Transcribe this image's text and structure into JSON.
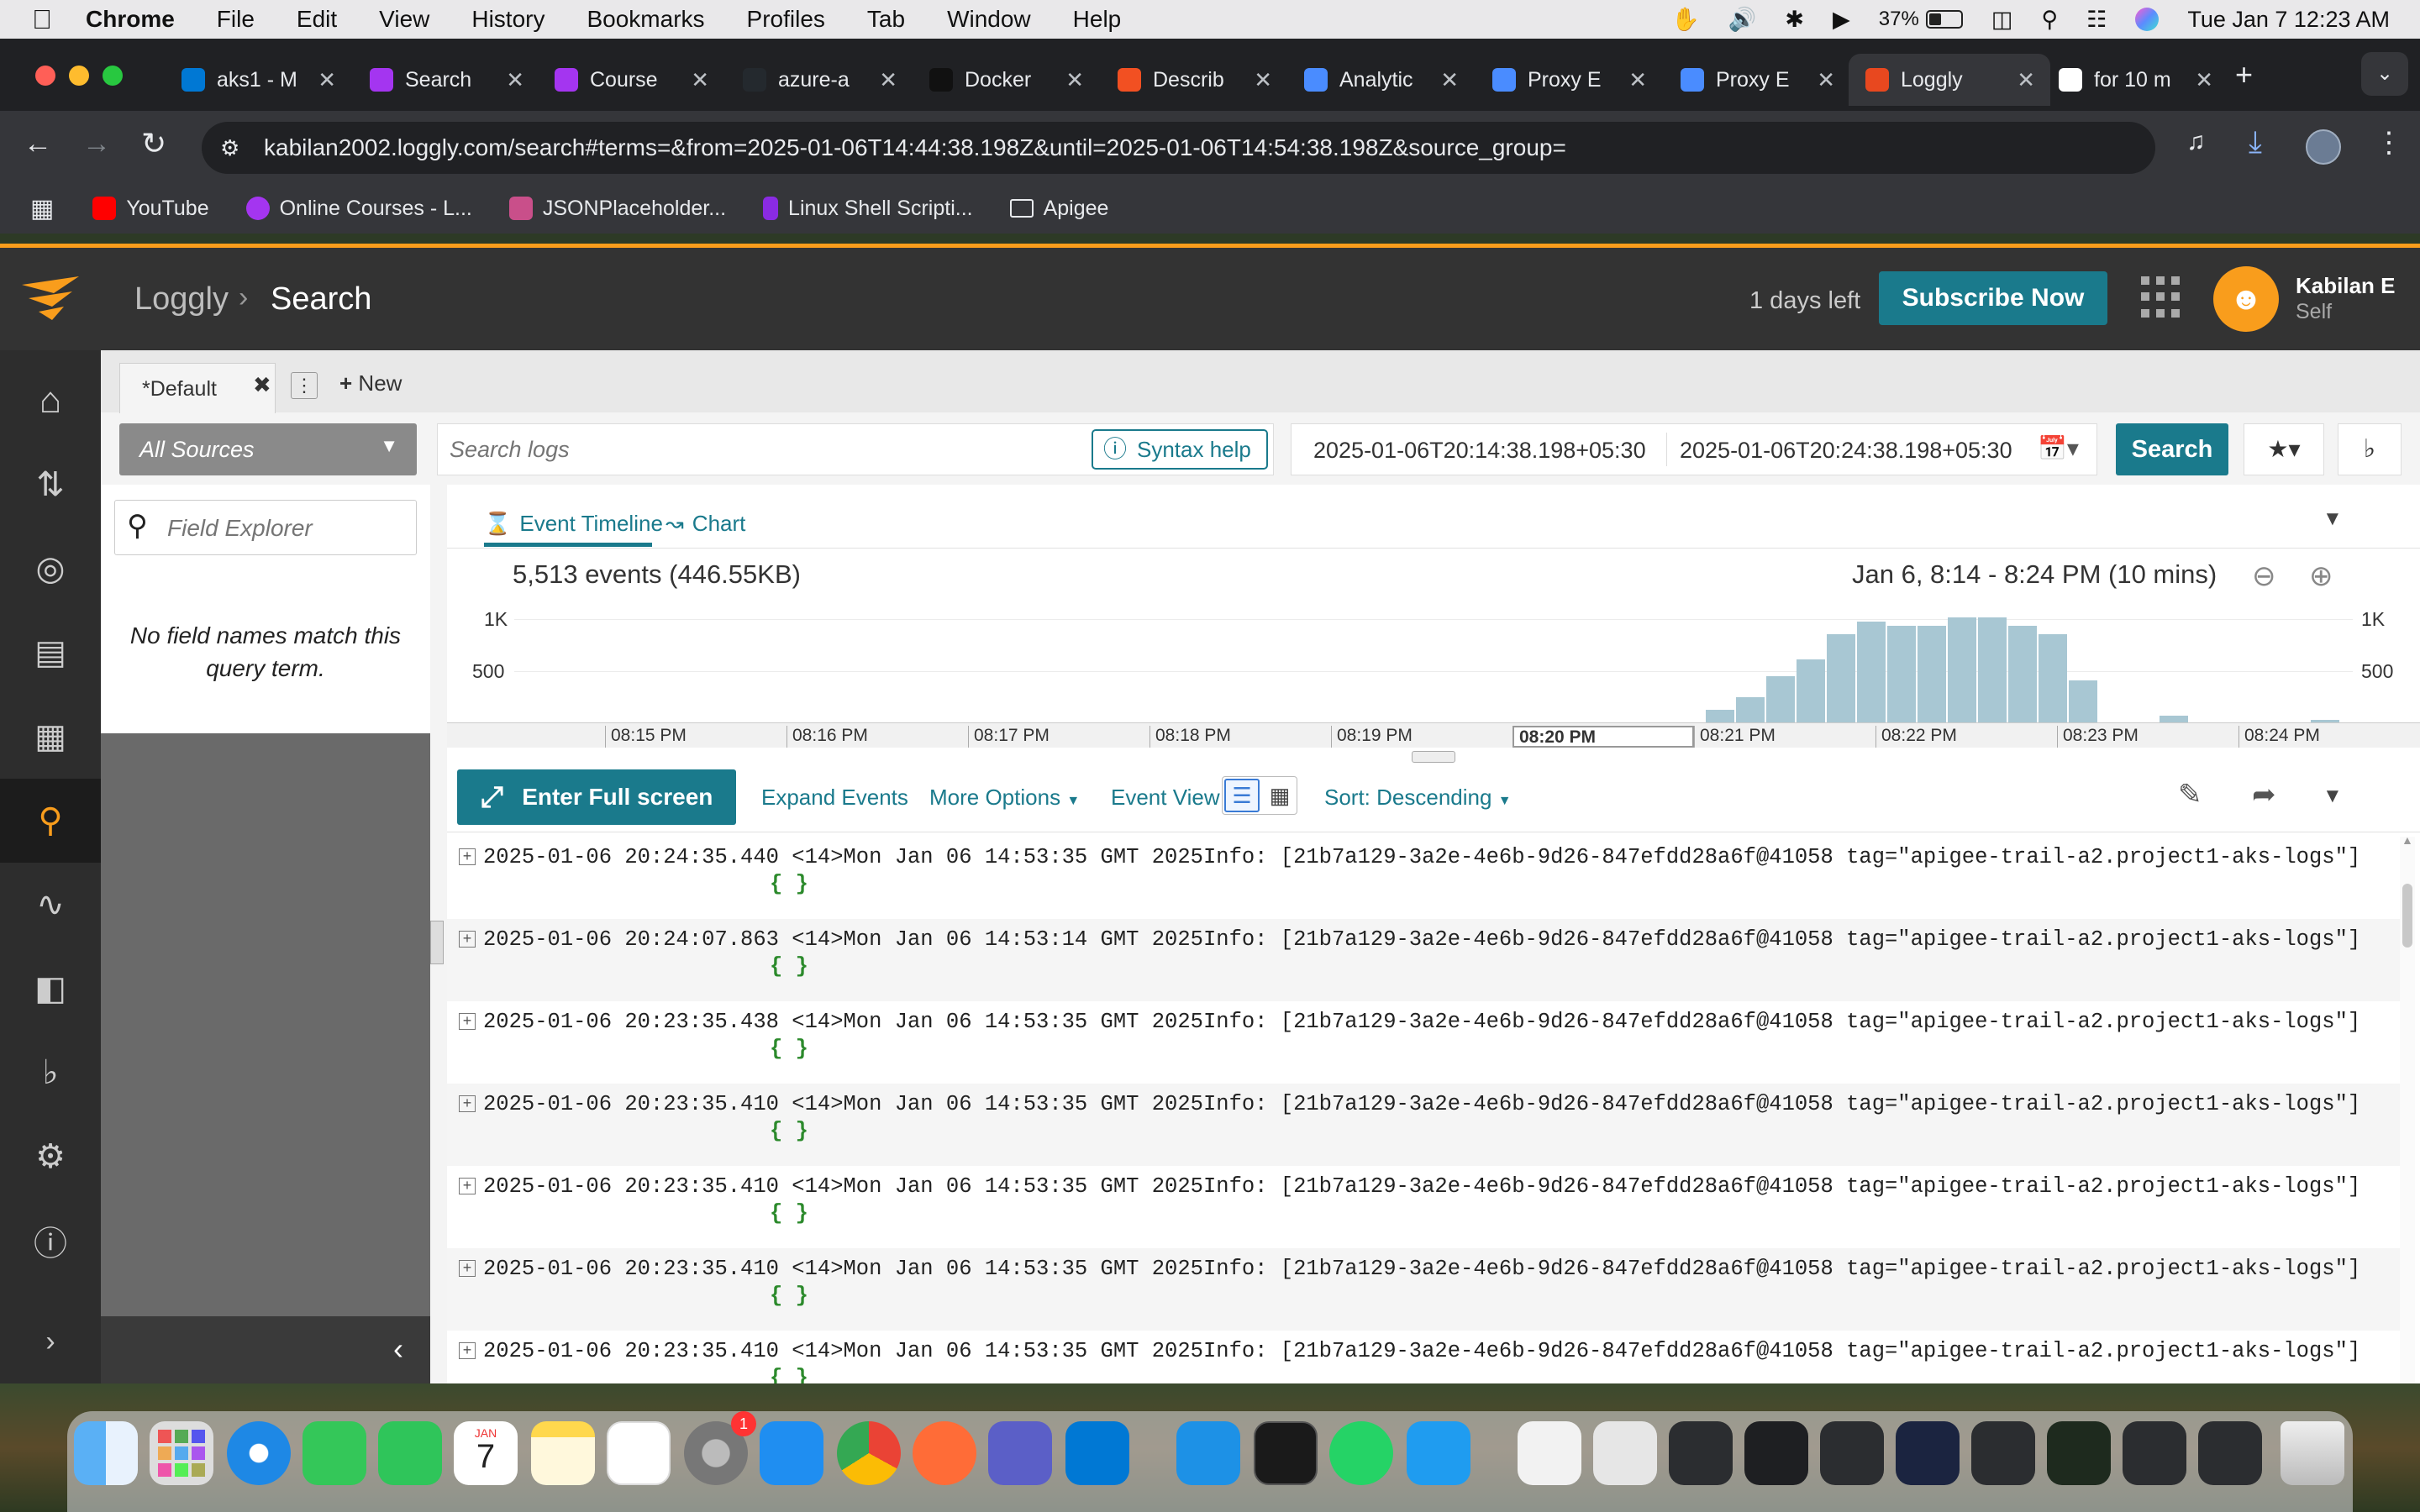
{
  "menubar": {
    "app": "Chrome",
    "items": [
      "File",
      "Edit",
      "View",
      "History",
      "Bookmarks",
      "Profiles",
      "Tab",
      "Window",
      "Help"
    ],
    "battery": "37%",
    "datetime": "Tue Jan 7  12:23 AM"
  },
  "tabs": [
    {
      "label": "aks1 - M",
      "color": "#0078d4",
      "icon": "azure-icon"
    },
    {
      "label": "Search",
      "color": "#a435f0",
      "icon": "udemy-icon"
    },
    {
      "label": "Course",
      "color": "#a435f0",
      "icon": "udemy-icon"
    },
    {
      "label": "azure-a",
      "color": "#24292e",
      "icon": "github-icon"
    },
    {
      "label": "Docker",
      "color": "#111111",
      "icon": "chatgpt-icon"
    },
    {
      "label": "Describ",
      "color": "#f25022",
      "icon": "microsoft-icon"
    },
    {
      "label": "Analytic",
      "color": "#4a8cff",
      "icon": "apigee-icon"
    },
    {
      "label": "Proxy E",
      "color": "#4a8cff",
      "icon": "apigee-icon"
    },
    {
      "label": "Proxy E",
      "color": "#4a8cff",
      "icon": "apigee-icon"
    },
    {
      "label": "Loggly",
      "color": "#e8481f",
      "icon": "loggly-icon"
    },
    {
      "label": "for 10 m",
      "color": "#ffffff",
      "icon": "google-icon"
    }
  ],
  "url": "kabilan2002.loggly.com/search#terms=&from=2025-01-06T14:44:38.198Z&until=2025-01-06T14:54:38.198Z&source_group=",
  "bookmarks": [
    {
      "label": "YouTube",
      "color": "#ff0000"
    },
    {
      "label": "Online Courses - L...",
      "color": "#a435f0"
    },
    {
      "label": "JSONPlaceholder...",
      "color": "#c94f8a"
    },
    {
      "label": "Linux Shell Scripti...",
      "color": "#8a2be2"
    },
    {
      "label": "Apigee",
      "color": "#e8eaed"
    }
  ],
  "loggly": {
    "brand": "Loggly",
    "page": "Search",
    "trial": "1 days left",
    "subscribe": "Subscribe Now",
    "user_name": "Kabilan E",
    "user_org": "Self",
    "accent": "#1a7a8c"
  },
  "search": {
    "tab_default": "*Default",
    "new_label": "New",
    "source": "All Sources",
    "placeholder": "Search logs",
    "syntax_help": "Syntax help",
    "from": "2025-01-06T20:14:38.198+05:30",
    "until": "2025-01-06T20:24:38.198+05:30",
    "search_btn": "Search"
  },
  "field_explorer": {
    "placeholder": "Field Explorer",
    "empty": "No field names match this query term."
  },
  "timeline": {
    "tab_timeline": "Event Timeline",
    "tab_chart": "Chart",
    "summary": "5,513 events (446.55KB)",
    "range": "Jan 6, 8:14 - 8:24 PM  (10 mins)",
    "y_1k": "1K",
    "y_500": "500",
    "x_labels": [
      "08:15 PM",
      "08:16 PM",
      "08:17 PM",
      "08:18 PM",
      "08:19 PM",
      "08:20 PM",
      "08:21 PM",
      "08:22 PM",
      "08:23 PM",
      "08:24 PM"
    ],
    "bars": [
      15,
      30,
      55,
      75,
      105,
      120,
      115,
      115,
      125,
      125,
      115,
      105,
      50,
      0,
      0,
      8,
      0,
      0,
      0,
      0,
      3
    ]
  },
  "events_toolbar": {
    "fullscreen": "Enter Full screen",
    "expand": "Expand Events",
    "more": "More Options",
    "view": "Event View",
    "sort": "Sort: Descending"
  },
  "events": [
    {
      "ts": "2025-01-06 20:24:35.440",
      "msg": "<14>Mon Jan 06 14:53:35 GMT 2025Info: [21b7a129-3a2e-4e6b-9d26-847efdd28a6f@41058 tag=\"apigee-trail-a2.project1-aks-logs\"]",
      "body": "{ }"
    },
    {
      "ts": "2025-01-06 20:24:07.863",
      "msg": "<14>Mon Jan 06 14:53:14 GMT 2025Info: [21b7a129-3a2e-4e6b-9d26-847efdd28a6f@41058 tag=\"apigee-trail-a2.project1-aks-logs\"]",
      "body": "{ }"
    },
    {
      "ts": "2025-01-06 20:23:35.438",
      "msg": "<14>Mon Jan 06 14:53:35 GMT 2025Info: [21b7a129-3a2e-4e6b-9d26-847efdd28a6f@41058 tag=\"apigee-trail-a2.project1-aks-logs\"]",
      "body": "{ }"
    },
    {
      "ts": "2025-01-06 20:23:35.410",
      "msg": "<14>Mon Jan 06 14:53:35 GMT 2025Info: [21b7a129-3a2e-4e6b-9d26-847efdd28a6f@41058 tag=\"apigee-trail-a2.project1-aks-logs\"]",
      "body": "{ }"
    },
    {
      "ts": "2025-01-06 20:23:35.410",
      "msg": "<14>Mon Jan 06 14:53:35 GMT 2025Info: [21b7a129-3a2e-4e6b-9d26-847efdd28a6f@41058 tag=\"apigee-trail-a2.project1-aks-logs\"]",
      "body": "{ }"
    },
    {
      "ts": "2025-01-06 20:23:35.410",
      "msg": "<14>Mon Jan 06 14:53:35 GMT 2025Info: [21b7a129-3a2e-4e6b-9d26-847efdd28a6f@41058 tag=\"apigee-trail-a2.project1-aks-logs\"]",
      "body": "{ }"
    },
    {
      "ts": "2025-01-06 20:23:35.410",
      "msg": "<14>Mon Jan 06 14:53:35 GMT 2025Info: [21b7a129-3a2e-4e6b-9d26-847efdd28a6f@41058 tag=\"apigee-trail-a2.project1-aks-logs\"]",
      "body": "{ }"
    }
  ],
  "dock": {
    "calendar_month": "JAN",
    "calendar_day": "7",
    "settings_badge": "1"
  }
}
